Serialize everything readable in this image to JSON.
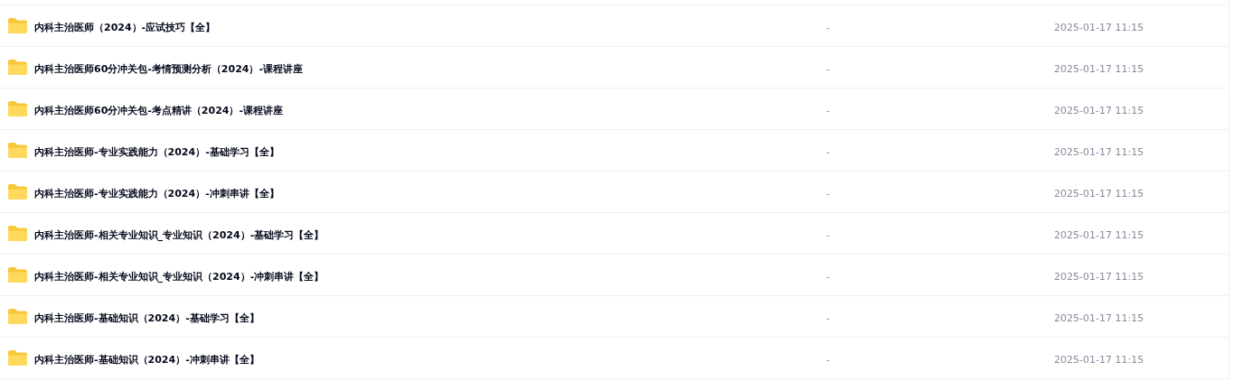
{
  "files": [
    {
      "name": "内科主治医师（2024）-应试技巧【全】",
      "size": "-",
      "modified": "2025-01-17 11:15"
    },
    {
      "name": "内科主治医师60分冲关包-考情预测分析（2024）-课程讲座",
      "size": "-",
      "modified": "2025-01-17 11:15"
    },
    {
      "name": "内科主治医师60分冲关包-考点精讲（2024）-课程讲座",
      "size": "-",
      "modified": "2025-01-17 11:15"
    },
    {
      "name": "内科主治医师-专业实践能力（2024）-基础学习【全】",
      "size": "-",
      "modified": "2025-01-17 11:15"
    },
    {
      "name": "内科主治医师-专业实践能力（2024）-冲刺串讲【全】",
      "size": "-",
      "modified": "2025-01-17 11:15"
    },
    {
      "name": "内科主治医师-相关专业知识_专业知识（2024）-基础学习【全】",
      "size": "-",
      "modified": "2025-01-17 11:15"
    },
    {
      "name": "内科主治医师-相关专业知识_专业知识（2024）-冲刺串讲【全】",
      "size": "-",
      "modified": "2025-01-17 11:15"
    },
    {
      "name": "内科主治医师-基础知识（2024）-基础学习【全】",
      "size": "-",
      "modified": "2025-01-17 11:15"
    },
    {
      "name": "内科主治医师-基础知识（2024）-冲刺串讲【全】",
      "size": "-",
      "modified": "2025-01-17 11:15"
    }
  ]
}
